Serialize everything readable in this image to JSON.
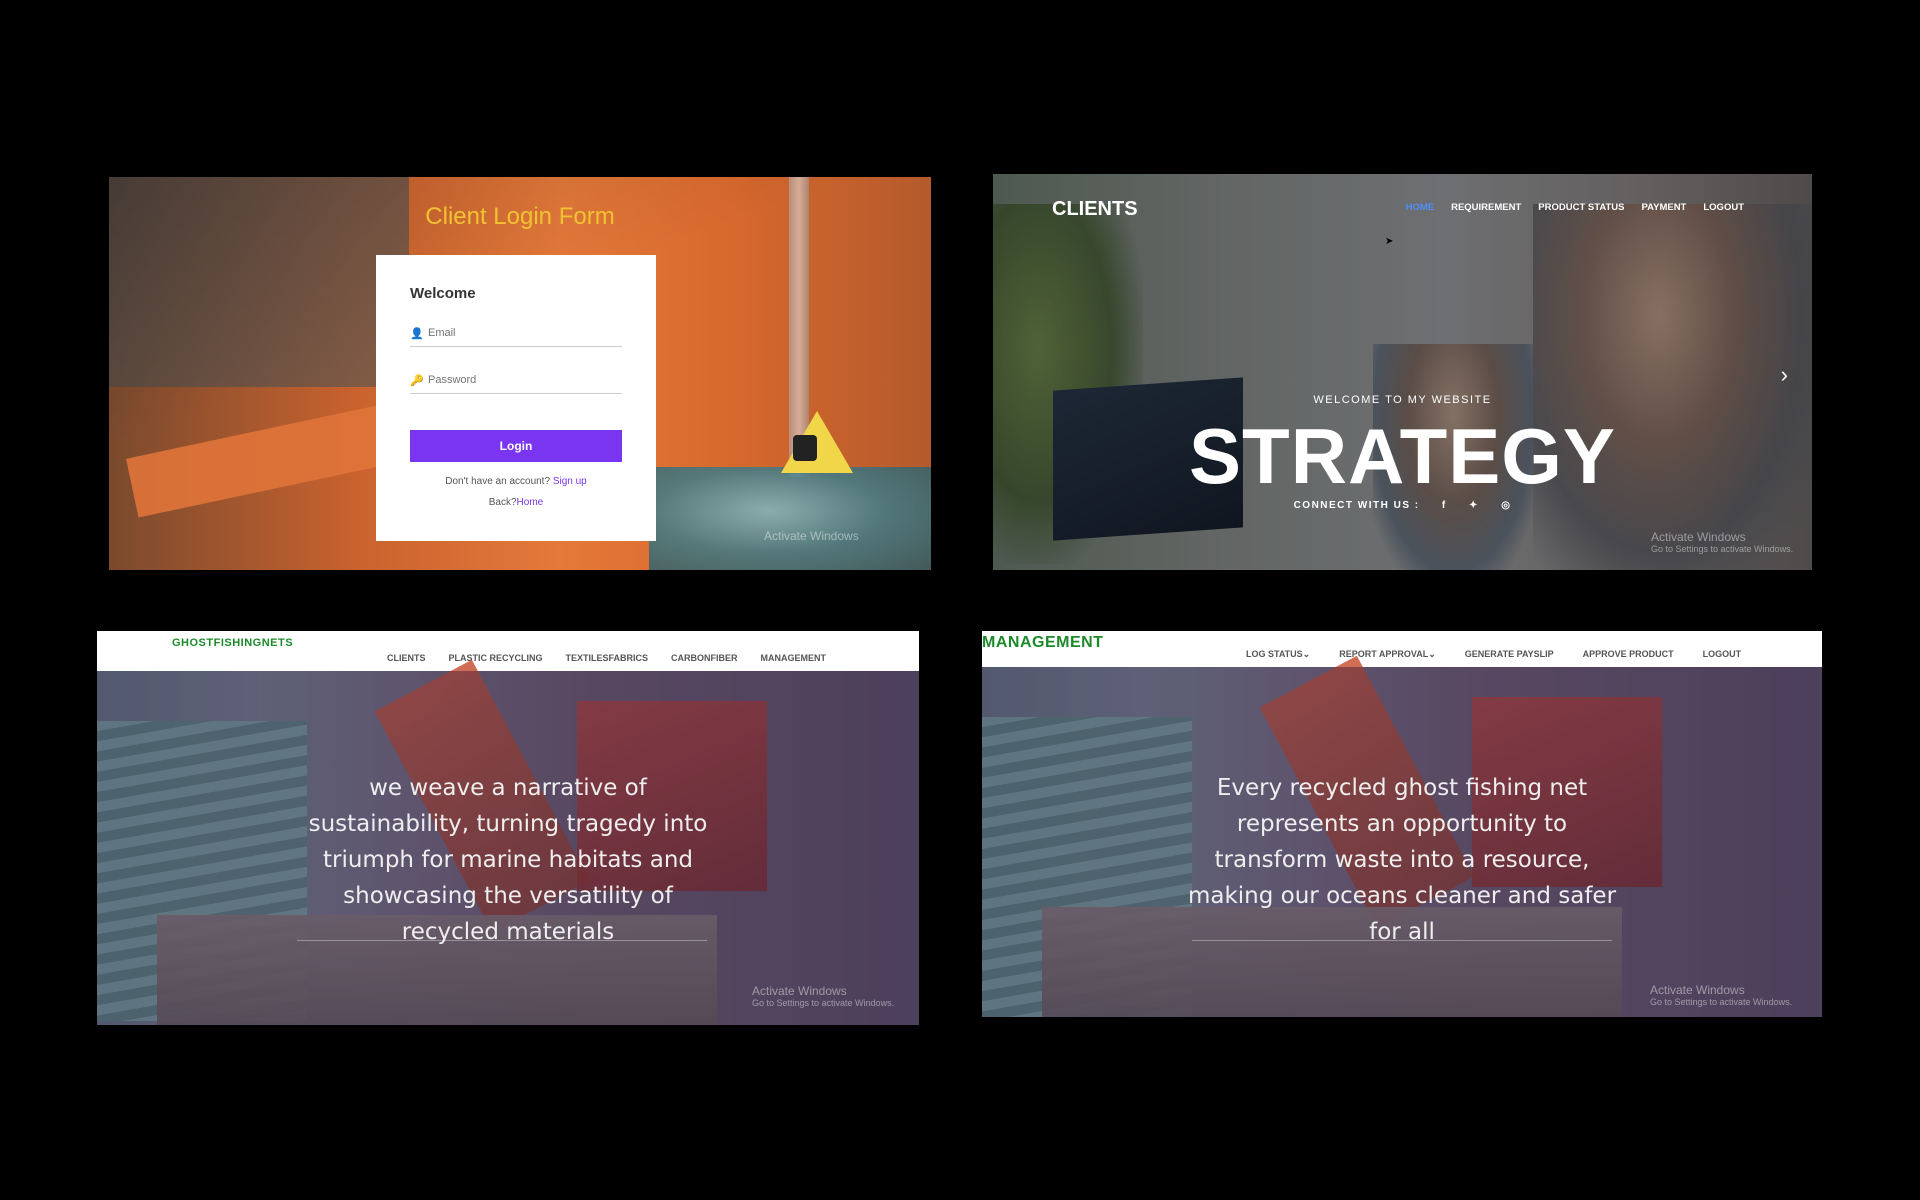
{
  "login_panel": {
    "form_title": "Client Login Form",
    "heading": "Welcome",
    "email_placeholder": "Email",
    "password_placeholder": "Password",
    "login_label": "Login",
    "signup_prompt": "Don't have an account?",
    "signup_link": "Sign up",
    "back_prompt": "Back?",
    "home_link": "Home",
    "watermark": "Activate Windows"
  },
  "clients_panel": {
    "logo": "CLIENTS",
    "nav": [
      "HOME",
      "REQUIREMENT",
      "PRODUCT STATUS",
      "PAYMENT",
      "LOGOUT"
    ],
    "active_nav": "HOME",
    "welcome": "WELCOME TO MY WEBSITE",
    "headline": "STRATEGY",
    "connect": "CONNECT WITH US :",
    "social_icons": [
      "facebook-icon",
      "twitter-icon",
      "dribbble-icon"
    ],
    "watermark": "Activate Windows",
    "watermark_sub": "Go to Settings to activate Windows."
  },
  "ghostnets_panel": {
    "brand": "GHOSTFISHINGNETS",
    "nav": [
      "CLIENTS",
      "PLASTIC RECYCLING",
      "TEXTILESFABRICS",
      "CARBONFIBER",
      "MANAGEMENT"
    ],
    "caption": "we weave a narrative of sustainability, turning tragedy into triumph for marine habitats and showcasing the versatility of recycled materials",
    "watermark": "Activate Windows",
    "watermark_sub": "Go to Settings to activate Windows."
  },
  "management_panel": {
    "brand": "MANAGEMENT",
    "nav": [
      "LOG STATUS⌄",
      "REPORT APPROVAL⌄",
      "GENERATE PAYSLIP",
      "APPROVE PRODUCT",
      "LOGOUT"
    ],
    "caption": "Every recycled ghost fishing net represents an opportunity to transform waste into a resource, making our oceans cleaner and safer for all",
    "watermark": "Activate Windows",
    "watermark_sub": "Go to Settings to activate Windows."
  },
  "colors": {
    "login_button": "#7a35f0",
    "form_title": "#f1c232",
    "active_nav": "#4f8ff7",
    "brand_green": "#1c8a2a"
  }
}
